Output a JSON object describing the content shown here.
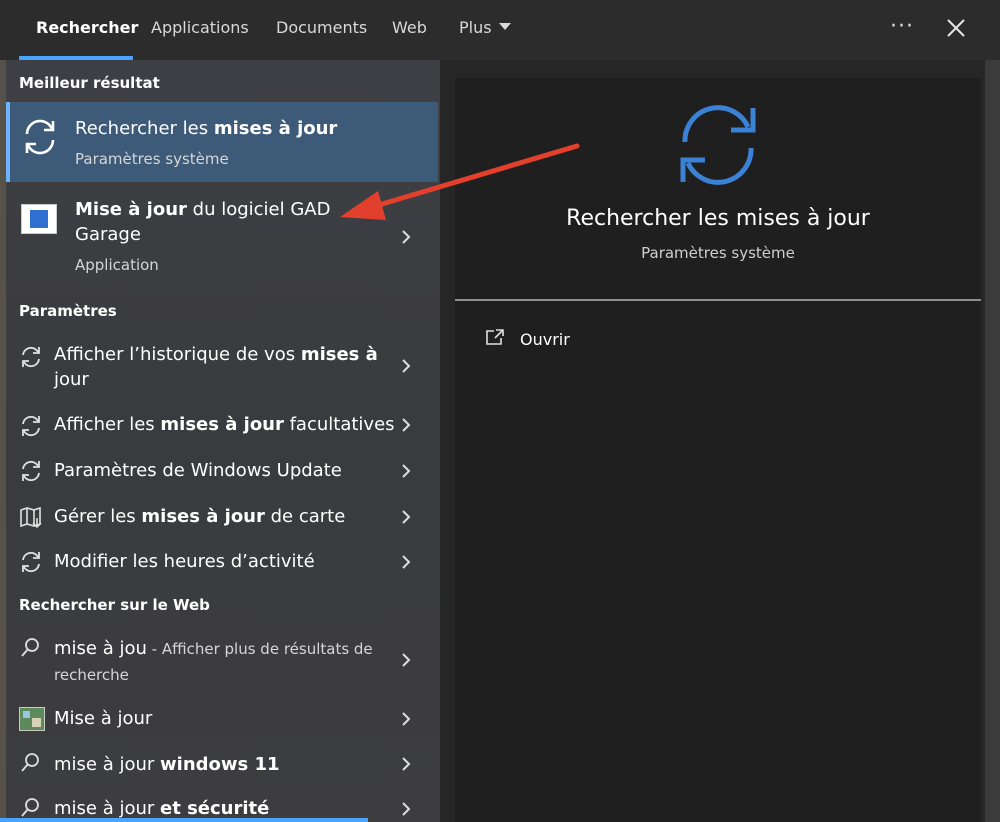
{
  "tabs": [
    "Rechercher",
    "Applications",
    "Documents",
    "Web",
    "Plus"
  ],
  "window": {
    "more_icon": "···"
  },
  "sections": {
    "best": "Meilleur résultat",
    "settings": "Paramètres",
    "web": "Rechercher sur le Web"
  },
  "best_result": {
    "title_pre": "Rechercher les ",
    "title_bold": "mises à jour",
    "subtitle": "Paramètres système"
  },
  "app_result": {
    "line1_bold": "Mise à jour",
    "line1_rest": " du logiciel GAD",
    "line2": "Garage",
    "subtitle": "Application"
  },
  "settings_items": [
    {
      "pre": "Afficher l’historique de vos ",
      "bold": "mises à",
      "line2": "jour",
      "icon": "refresh-icon"
    },
    {
      "pre": "Afficher les ",
      "bold": "mises à jour",
      "post": " facultatives",
      "icon": "refresh-icon"
    },
    {
      "pre": "Paramètres de Windows Update",
      "icon": "refresh-icon"
    },
    {
      "pre": "Gérer les ",
      "bold": "mises à jour",
      "post": " de carte",
      "icon": "map-icon"
    },
    {
      "pre": "Modifier les heures d’activité",
      "icon": "refresh-icon"
    }
  ],
  "web_items": [
    {
      "pre": "mise à jou",
      "suffix": " - Afficher plus de résultats de",
      "line2": "recherche",
      "icon": "search-icon"
    },
    {
      "pre": "Mise à jour",
      "icon": "image-thumbnail-icon"
    },
    {
      "pre": "mise à jour ",
      "bold": "windows 11",
      "icon": "search-icon"
    },
    {
      "pre": "mise à jour ",
      "bold": "et sécurité",
      "icon": "search-icon"
    }
  ],
  "preview": {
    "title": "Rechercher les mises à jour",
    "subtitle": "Paramètres système",
    "open_label": "Ouvrir"
  },
  "colors": {
    "accent": "#4aa3ff",
    "selected_bg": "#3d5a78",
    "arrow": "#e2402c",
    "sync_icon": "#3b82d6"
  }
}
